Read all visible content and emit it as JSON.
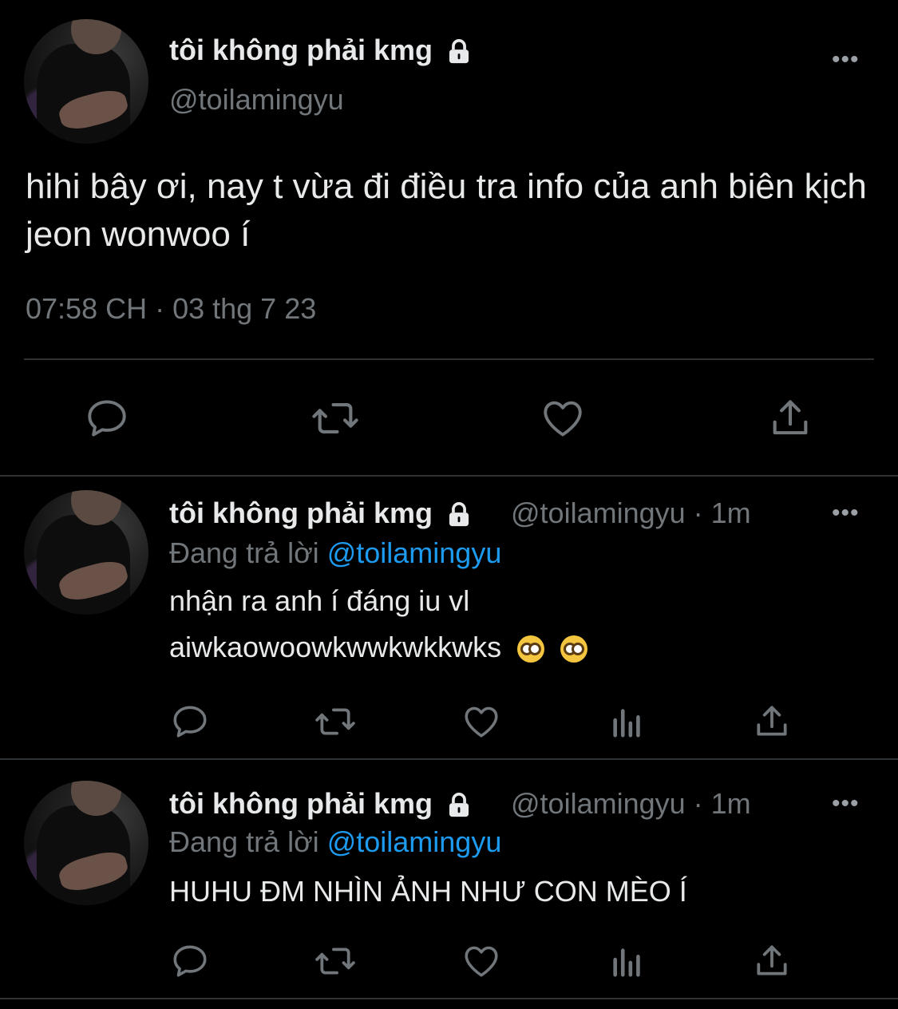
{
  "main_tweet": {
    "display_name": "tôi không phải kmg",
    "handle": "@toilamingyu",
    "text": "hihi bây ơi, nay t vừa đi điều tra info của anh biên kịch jeon wonwoo í",
    "timestamp": "07:58 CH · 03 thg 7 23",
    "more": "•••"
  },
  "replies": [
    {
      "display_name": "tôi không phải kmg",
      "handle_time": "@toilamingyu · 1m",
      "replying_prefix": "Đang trả lời",
      "replying_to": "@toilamingyu",
      "text_line1": "nhận ra anh í đáng iu vl",
      "text_line2": "aiwkaowoowkwwkwkkwks",
      "emojis": [
        "nerd-face",
        "nerd-face"
      ],
      "more": "•••"
    },
    {
      "display_name": "tôi không phải kmg",
      "handle_time": "@toilamingyu · 1m",
      "replying_prefix": "Đang trả lời",
      "replying_to": "@toilamingyu",
      "text_line1": "HUHU ĐM NHÌN ẢNH NHƯ CON MÈO Í",
      "more": "•••"
    }
  ],
  "icons": {
    "reply": "reply-icon",
    "retweet": "retweet-icon",
    "like": "heart-icon",
    "views": "analytics-icon",
    "share": "share-icon",
    "lock": "lock-icon"
  },
  "colors": {
    "background": "#000000",
    "text": "#e7e9ea",
    "muted": "#71767b",
    "link": "#1d9bf0",
    "divider": "#2f3336"
  }
}
